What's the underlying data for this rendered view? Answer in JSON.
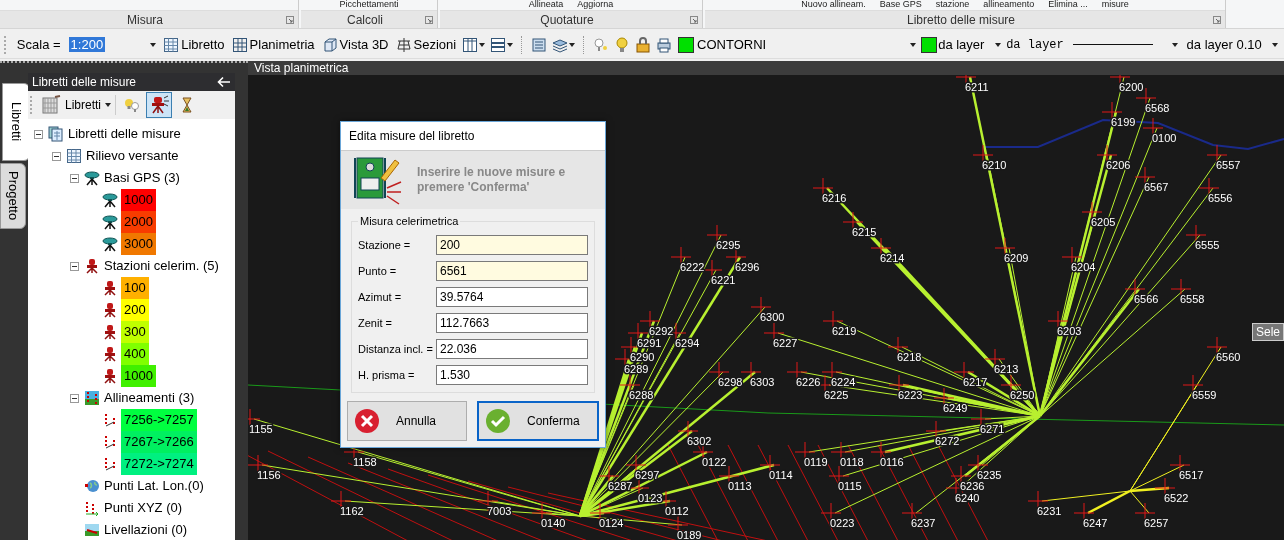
{
  "ribbon": {
    "groups": [
      {
        "label": "Misura"
      },
      {
        "label": "Calcoli",
        "commands": [
          "Picchettamenti"
        ]
      },
      {
        "label": "Quotature",
        "commands": [
          "Allineata",
          "Aggiorna"
        ]
      },
      {
        "label": "Libretto delle misure",
        "commands": [
          "Nuovo allineam.",
          "Base GPS",
          "stazione",
          "allineamento",
          "Elimina ...",
          "misure"
        ]
      }
    ]
  },
  "toolbar": {
    "scale_label": "Scala =",
    "scale_value": "1:200",
    "view_buttons": [
      "Libretto",
      "Planimetria",
      "Vista 3D",
      "Sezioni"
    ],
    "layer": "CONTORNI",
    "color_combo": "da layer",
    "linetype_combo": "da layer",
    "lineweight_combo": "da layer 0.10"
  },
  "side_tabs": [
    {
      "label": "Libretti",
      "selected": true
    },
    {
      "label": "Progetto",
      "selected": false
    }
  ],
  "panel": {
    "title": "Libretti delle misure",
    "dropdown": "Libretti",
    "tools": [
      {
        "kind": "bulbs",
        "pressed": false
      },
      {
        "kind": "station",
        "pressed": true
      },
      {
        "kind": "hourglass",
        "pressed": false
      }
    ],
    "tree": [
      {
        "label": "Libretti delle misure",
        "kind": "books",
        "expanded": true,
        "children": [
          {
            "label": "Rilievo versante",
            "kind": "table",
            "expanded": true,
            "children": [
              {
                "label": "Basi GPS (3)",
                "kind": "gps",
                "expanded": true,
                "children": [
                  {
                    "label": "1000",
                    "kind": "gps",
                    "color": "#ff0000"
                  },
                  {
                    "label": "2000",
                    "kind": "gps",
                    "color": "#f83c00"
                  },
                  {
                    "label": "3000",
                    "kind": "gps",
                    "color": "#f07800"
                  }
                ]
              },
              {
                "label": "Stazioni celerim. (5)",
                "kind": "station",
                "expanded": true,
                "children": [
                  {
                    "label": "100",
                    "kind": "station",
                    "color": "#ffb000"
                  },
                  {
                    "label": "200",
                    "kind": "station",
                    "color": "#ffff00"
                  },
                  {
                    "label": "300",
                    "kind": "station",
                    "color": "#c0ff00"
                  },
                  {
                    "label": "400",
                    "kind": "station",
                    "color": "#80ff00"
                  },
                  {
                    "label": "1000",
                    "kind": "station",
                    "color": "#40f000"
                  }
                ]
              },
              {
                "label": "Allineamenti (3)",
                "kind": "alignment_group",
                "expanded": true,
                "children": [
                  {
                    "label": "7256->7257",
                    "kind": "alignment",
                    "color": "#00ff40"
                  },
                  {
                    "label": "7267->7266",
                    "kind": "alignment",
                    "color": "#00f060"
                  },
                  {
                    "label": "7272->7274",
                    "kind": "alignment",
                    "color": "#00f080"
                  }
                ]
              },
              {
                "label": "Punti Lat. Lon.(0)",
                "kind": "globe"
              },
              {
                "label": "Punti XYZ (0)",
                "kind": "xyz"
              },
              {
                "label": "Livellazioni (0)",
                "kind": "level"
              }
            ]
          }
        ]
      }
    ]
  },
  "view": {
    "title": "Vista planimetrica",
    "tooltip": "Sele",
    "point_labels": [
      "6211",
      "6200",
      "6568",
      "6199",
      "0100",
      "6210",
      "6206",
      "6557",
      "6567",
      "6216",
      "6556",
      "6205",
      "6215",
      "6295",
      "6555",
      "6214",
      "6209",
      "6222",
      "6296",
      "6204",
      "6221",
      "6566",
      "6558",
      "6300",
      "6292",
      "6219",
      "6203",
      "6291",
      "6294",
      "6227",
      "6290",
      "6218",
      "6560",
      "6289",
      "6213",
      "6298",
      "6303",
      "6226",
      "6224",
      "6217",
      "6288",
      "6225",
      "6223",
      "6250",
      "6559",
      "6249",
      "1155",
      "6271",
      "6302",
      "6272",
      "1158",
      "0122",
      "0119",
      "0118",
      "0116",
      "1156",
      "6297",
      "0114",
      "6235",
      "6517",
      "6287",
      "0113",
      "0115",
      "6236",
      "0123",
      "6240",
      "6522",
      "1162",
      "7003",
      "0112",
      "6231",
      "0140",
      "0124",
      "0223",
      "6237",
      "6247",
      "6257",
      "0189"
    ]
  },
  "dialog": {
    "title": "Edita misure del libretto",
    "message": "Inserire le nuove misure e premere 'Conferma'",
    "group": "Misura celerimetrica",
    "fields": [
      {
        "label": "Stazione =",
        "value": "200",
        "highlighted": true
      },
      {
        "label": "Punto =",
        "value": "6561",
        "highlighted": true
      },
      {
        "label": "Azimut =",
        "value": "39.5764",
        "highlighted": false
      },
      {
        "label": "Zenit =",
        "value": "112.7663",
        "highlighted": false
      },
      {
        "label": "Distanza incl. =",
        "value": "22.036",
        "highlighted": false
      },
      {
        "label": "H. prisma =",
        "value": "1.530",
        "highlighted": false
      }
    ],
    "buttons": [
      {
        "label": "Annulla",
        "kind": "cancel",
        "focused": false
      },
      {
        "label": "Conferma",
        "kind": "confirm",
        "focused": true
      }
    ]
  }
}
